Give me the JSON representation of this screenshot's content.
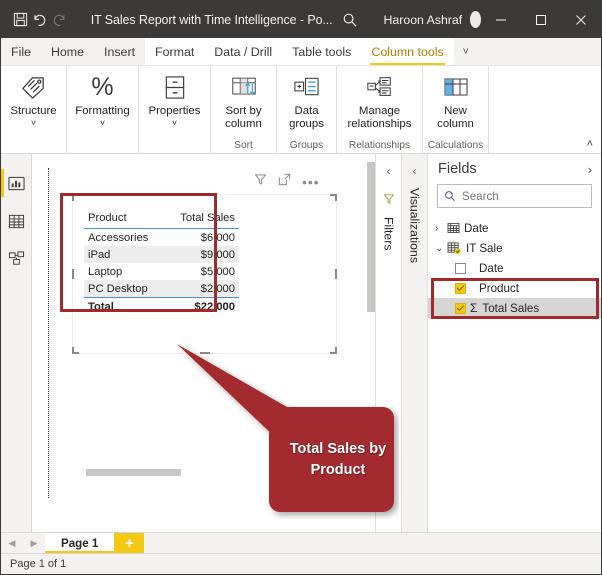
{
  "titlebar": {
    "save_icon": "save-icon",
    "undo_icon": "undo-icon",
    "redo_icon": "redo-icon",
    "title": "IT Sales Report with Time Intelligence - Po...",
    "search_icon": "search-icon",
    "user_name": "Haroon Ashraf",
    "minimize": "minimize-icon",
    "maximize": "maximize-icon",
    "close": "close-icon"
  },
  "ribbon_tabs": [
    {
      "label": "File",
      "active": false,
      "white_bg": false
    },
    {
      "label": "Home",
      "active": false,
      "white_bg": false
    },
    {
      "label": "Insert",
      "active": false,
      "white_bg": false
    },
    {
      "label": "Format",
      "active": false,
      "white_bg": true
    },
    {
      "label": "Data / Drill",
      "active": false,
      "white_bg": true
    },
    {
      "label": "Table tools",
      "active": false,
      "white_bg": true
    },
    {
      "label": "Column tools",
      "active": true,
      "white_bg": true
    }
  ],
  "ribbon_overflow_icon": "chevron-down-icon",
  "ribbon_groups": [
    {
      "group_name": "",
      "buttons": [
        {
          "label": "Structure",
          "icon": "tag-icon",
          "caret": true
        }
      ]
    },
    {
      "group_name": "",
      "buttons": [
        {
          "label": "Formatting",
          "icon": "percent-icon",
          "caret": true
        }
      ]
    },
    {
      "group_name": "",
      "buttons": [
        {
          "label": "Properties",
          "icon": "cabinet-icon",
          "caret": true
        }
      ]
    },
    {
      "group_name": "Sort",
      "buttons": [
        {
          "label": "Sort by\ncolumn",
          "icon": "sort-column-icon",
          "caret": false,
          "inline_caret": true
        }
      ]
    },
    {
      "group_name": "Groups",
      "buttons": [
        {
          "label": "Data\ngroups",
          "icon": "data-groups-icon",
          "caret": false,
          "inline_caret": true
        }
      ]
    },
    {
      "group_name": "Relationships",
      "buttons": [
        {
          "label": "Manage\nrelationships",
          "icon": "manage-relationships-icon",
          "caret": false
        }
      ]
    },
    {
      "group_name": "Calculations",
      "buttons": [
        {
          "label": "New\ncolumn",
          "icon": "new-column-icon",
          "caret": false
        }
      ]
    }
  ],
  "ribbon_collapse_icon": "chevron-up-icon",
  "view_rail": [
    {
      "name": "report-view",
      "icon": "bar-chart-icon",
      "active": true
    },
    {
      "name": "data-view",
      "icon": "table-icon",
      "active": false
    },
    {
      "name": "model-view",
      "icon": "model-icon",
      "active": false
    }
  ],
  "visual_header": {
    "filter_icon": "funnel-icon",
    "focus_icon": "focus-mode-icon",
    "more_icon": "more-options-icon",
    "more_label": "•••"
  },
  "table_visual": {
    "columns": [
      "Product",
      "Total Sales"
    ],
    "rows": [
      {
        "product": "Accessories",
        "total_sales": "$6,000"
      },
      {
        "product": "iPad",
        "total_sales": "$9,000"
      },
      {
        "product": "Laptop",
        "total_sales": "$5,000"
      },
      {
        "product": "PC Desktop",
        "total_sales": "$2,000"
      }
    ],
    "total_row": {
      "label": "Total",
      "value": "$22,000"
    }
  },
  "chart_data": {
    "type": "table",
    "title": "Total Sales by Product",
    "categories": [
      "Accessories",
      "iPad",
      "Laptop",
      "PC Desktop"
    ],
    "values": [
      6000,
      9000,
      5000,
      2000
    ],
    "total": 22000,
    "xlabel": "Product",
    "ylabel": "Total Sales",
    "value_format": "$#,##0"
  },
  "side_panels": [
    {
      "label": "Filters",
      "icon": "funnel-icon",
      "chevron": "chevron-left-icon"
    },
    {
      "label": "Visualizations",
      "icon": "",
      "chevron": "chevron-left-icon"
    }
  ],
  "fields_pane": {
    "title": "Fields",
    "expand_icon": "chevron-right-icon",
    "search_icon": "search-icon",
    "search_placeholder": "Search",
    "search_value": "",
    "items": [
      {
        "label": "Date",
        "type": "table",
        "expanded": false,
        "twisty": "›",
        "icon": "date-table-icon",
        "indent": 0,
        "checked": null,
        "sigma": false,
        "highlight": ""
      },
      {
        "label": "IT Sale",
        "type": "table",
        "expanded": true,
        "twisty": "⌄",
        "icon": "table-badge-icon",
        "indent": 0,
        "checked": null,
        "sigma": false,
        "highlight": ""
      },
      {
        "label": "Date",
        "type": "field",
        "indent": 1,
        "checked": false,
        "sigma": false,
        "highlight": ""
      },
      {
        "label": "Product",
        "type": "field",
        "indent": 1,
        "checked": true,
        "sigma": false,
        "highlight": "white"
      },
      {
        "label": "Total Sales",
        "type": "measure",
        "indent": 1,
        "checked": true,
        "sigma": true,
        "highlight": "grey"
      }
    ]
  },
  "callout": {
    "text": "Total Sales by Product",
    "color": "#a32a2e"
  },
  "page_tabs": {
    "prev_icon": "chevron-left-icon",
    "next_icon": "chevron-right-icon",
    "tabs": [
      {
        "label": "Page 1",
        "active": true
      }
    ],
    "add_label": "+"
  },
  "status_bar": {
    "text": "Page 1 of 1"
  },
  "colors": {
    "accent_yellow": "#f2c811",
    "annotation_red": "#9e2a2b",
    "callout_red": "#a32a2e",
    "titlebar": "#3b3a39",
    "table_rule_blue": "#4a8fd6"
  }
}
